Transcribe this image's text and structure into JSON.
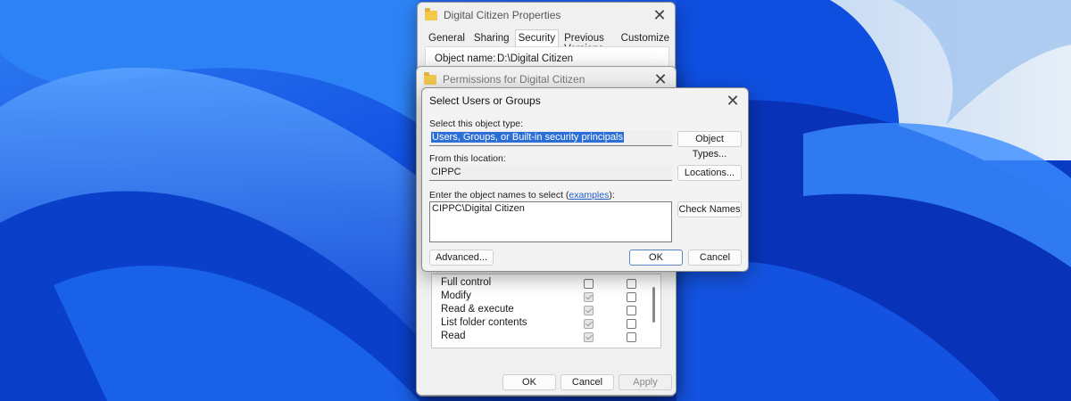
{
  "properties_window": {
    "title": "Digital Citizen Properties",
    "tabs": [
      "General",
      "Sharing",
      "Security",
      "Previous Versions",
      "Customize"
    ],
    "active_tab": "Security",
    "object_name_label": "Object name:",
    "object_name_value": "D:\\Digital Citizen",
    "ok_label": "OK",
    "cancel_label": "Cancel",
    "apply_label": "Apply"
  },
  "permissions_window": {
    "title": "Permissions for Digital Citizen",
    "permissions": [
      {
        "name": "Full control",
        "allow": false,
        "deny": false
      },
      {
        "name": "Modify",
        "allow": true,
        "deny": false
      },
      {
        "name": "Read & execute",
        "allow": true,
        "deny": false
      },
      {
        "name": "List folder contents",
        "allow": true,
        "deny": false
      },
      {
        "name": "Read",
        "allow": true,
        "deny": false
      }
    ]
  },
  "select_dialog": {
    "title": "Select Users or Groups",
    "object_type_label": "Select this object type:",
    "object_type_value": "Users, Groups, or Built-in security principals",
    "object_types_button": "Object Types...",
    "location_label": "From this location:",
    "location_value": "CIPPC",
    "locations_button": "Locations...",
    "names_label_prefix": "Enter the object names to select (",
    "names_label_link": "examples",
    "names_label_suffix": "):",
    "names_value": "CIPPC\\Digital Citizen",
    "check_names_button": "Check Names",
    "advanced_button": "Advanced...",
    "ok_button": "OK",
    "cancel_button": "Cancel"
  },
  "colors": {
    "wallpaper_deep": "#0b3fd6",
    "wallpaper_light": "#cfe0f5",
    "selection": "#2c6fd6",
    "link": "#1e5ec8"
  }
}
